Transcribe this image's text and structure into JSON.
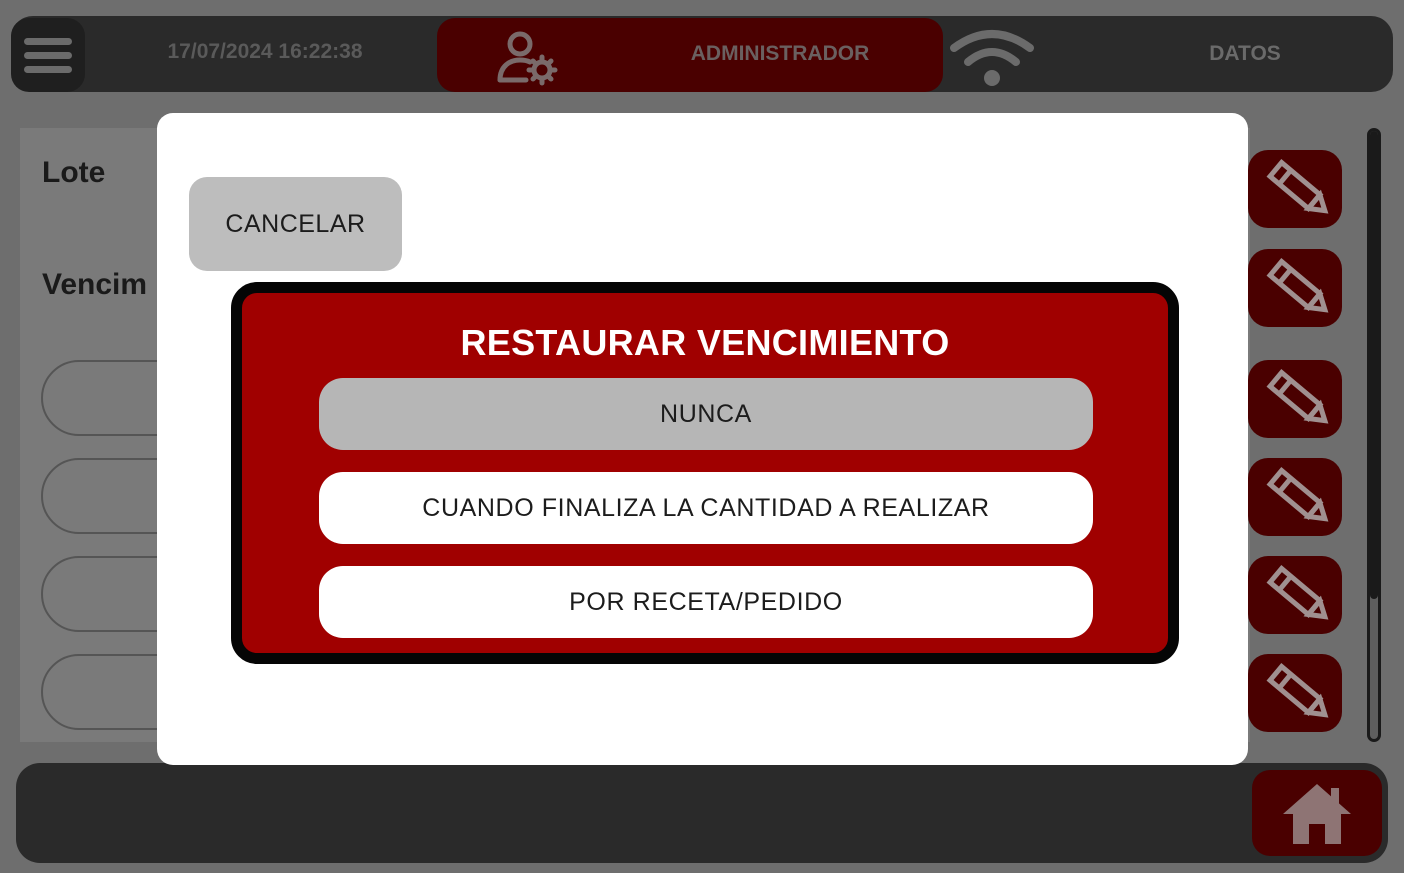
{
  "header": {
    "datetime": "17/07/2024 16:22:38",
    "user_role": "ADMINISTRADOR",
    "datos_label": "DATOS",
    "icons": {
      "menu": "hamburger-menu-icon",
      "user": "user-settings-icon",
      "wifi": "wifi-icon"
    }
  },
  "background_form": {
    "lote_label": "Lote",
    "vencimiento_label": "Vencim",
    "edit_icon": "pencil-icon"
  },
  "footer": {
    "home_icon": "home-icon"
  },
  "modal": {
    "cancel_label": "CANCELAR",
    "dialog_title": "RESTAURAR VENCIMIENTO",
    "options": [
      {
        "label": "NUNCA",
        "selected": true
      },
      {
        "label": "CUANDO FINALIZA LA CANTIDAD A REALIZAR",
        "selected": false
      },
      {
        "label": "POR RECETA/PEDIDO",
        "selected": false
      }
    ]
  },
  "colors": {
    "accent_red": "#a00000",
    "dark_red": "#4a0000",
    "bar_bg": "#2a2a2a",
    "selected_option": "#b6b6b6"
  }
}
